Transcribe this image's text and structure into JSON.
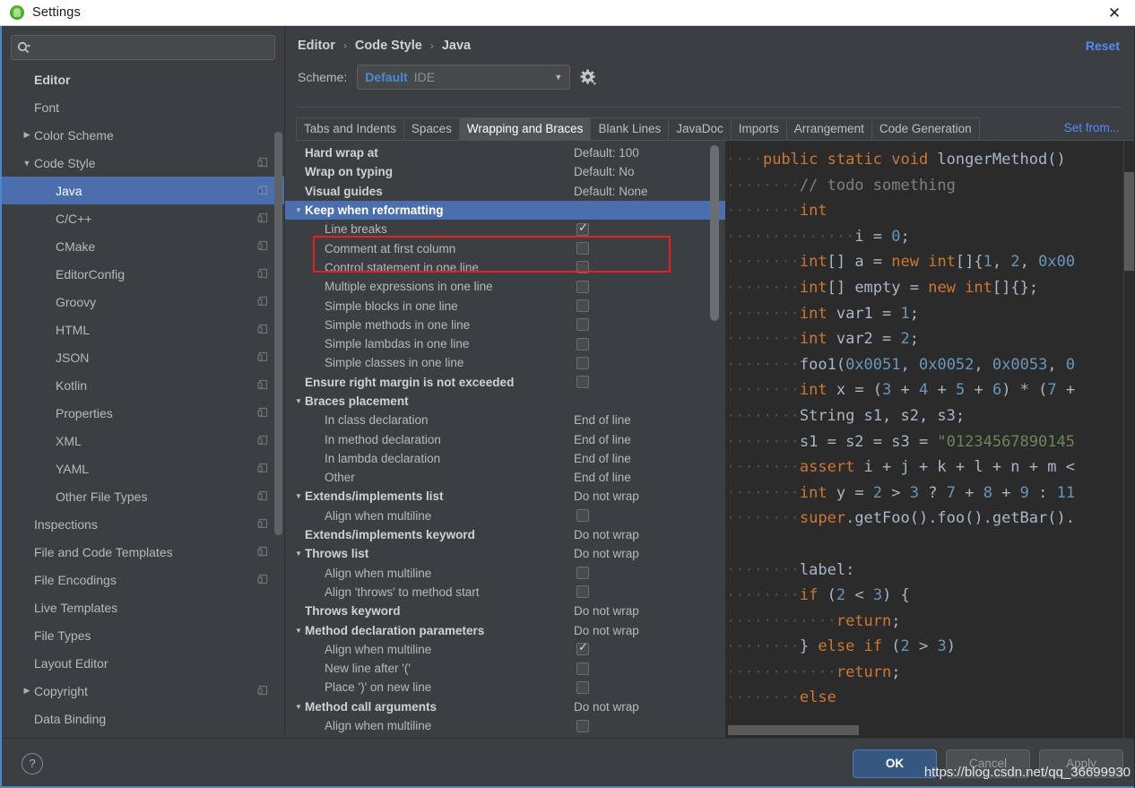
{
  "window": {
    "title": "Settings",
    "app_icon": "android-studio-icon",
    "close_icon": "close-icon"
  },
  "sidebar": {
    "search": {
      "placeholder": "",
      "value": "",
      "icon": "search-icon",
      "dropdown_icon": "chevron-down-icon"
    },
    "items": [
      {
        "label": "Editor",
        "level": 0,
        "arrow": "",
        "copy": false
      },
      {
        "label": "Font",
        "level": 1,
        "arrow": "",
        "copy": false
      },
      {
        "label": "Color Scheme",
        "level": 1,
        "arrow": "▶",
        "copy": false
      },
      {
        "label": "Code Style",
        "level": 1,
        "arrow": "▼",
        "copy": true
      },
      {
        "label": "Java",
        "level": 2,
        "arrow": "",
        "copy": true,
        "selected": true
      },
      {
        "label": "C/C++",
        "level": 2,
        "arrow": "",
        "copy": true
      },
      {
        "label": "CMake",
        "level": 2,
        "arrow": "",
        "copy": true
      },
      {
        "label": "EditorConfig",
        "level": 2,
        "arrow": "",
        "copy": true
      },
      {
        "label": "Groovy",
        "level": 2,
        "arrow": "",
        "copy": true
      },
      {
        "label": "HTML",
        "level": 2,
        "arrow": "",
        "copy": true
      },
      {
        "label": "JSON",
        "level": 2,
        "arrow": "",
        "copy": true
      },
      {
        "label": "Kotlin",
        "level": 2,
        "arrow": "",
        "copy": true
      },
      {
        "label": "Properties",
        "level": 2,
        "arrow": "",
        "copy": true
      },
      {
        "label": "XML",
        "level": 2,
        "arrow": "",
        "copy": true
      },
      {
        "label": "YAML",
        "level": 2,
        "arrow": "",
        "copy": true
      },
      {
        "label": "Other File Types",
        "level": 2,
        "arrow": "",
        "copy": true
      },
      {
        "label": "Inspections",
        "level": 1,
        "arrow": "",
        "copy": true
      },
      {
        "label": "File and Code Templates",
        "level": 1,
        "arrow": "",
        "copy": true
      },
      {
        "label": "File Encodings",
        "level": 1,
        "arrow": "",
        "copy": true
      },
      {
        "label": "Live Templates",
        "level": 1,
        "arrow": "",
        "copy": false
      },
      {
        "label": "File Types",
        "level": 1,
        "arrow": "",
        "copy": false
      },
      {
        "label": "Layout Editor",
        "level": 1,
        "arrow": "",
        "copy": false
      },
      {
        "label": "Copyright",
        "level": 1,
        "arrow": "▶",
        "copy": true
      },
      {
        "label": "Data Binding",
        "level": 1,
        "arrow": "",
        "copy": false
      }
    ]
  },
  "header": {
    "breadcrumb": [
      "Editor",
      "Code Style",
      "Java"
    ],
    "breadcrumb_separator": "›",
    "reset_label": "Reset",
    "scheme_label": "Scheme:",
    "scheme_value": "Default",
    "scheme_scope": "IDE",
    "scheme_dropdown_icon": "chevron-down-icon",
    "gear_icon": "gear-icon",
    "set_from_label": "Set from..."
  },
  "tabs": [
    {
      "label": "Tabs and Indents",
      "active": false
    },
    {
      "label": "Spaces",
      "active": false
    },
    {
      "label": "Wrapping and Braces",
      "active": true
    },
    {
      "label": "Blank Lines",
      "active": false
    },
    {
      "label": "JavaDoc",
      "active": false
    },
    {
      "label": "Imports",
      "active": false
    },
    {
      "label": "Arrangement",
      "active": false
    },
    {
      "label": "Code Generation",
      "active": false
    }
  ],
  "options": [
    {
      "label": "Hard wrap at",
      "kind": "group-nochev",
      "value": "Default: 100"
    },
    {
      "label": "Wrap on typing",
      "kind": "group-nochev",
      "value": "Default: No"
    },
    {
      "label": "Visual guides",
      "kind": "group-nochev",
      "value": "Default: None"
    },
    {
      "label": "Keep when reformatting",
      "kind": "group",
      "arrow": "▼",
      "selected": true
    },
    {
      "label": "Line breaks",
      "kind": "child",
      "checkbox": true,
      "checked": true
    },
    {
      "label": "Comment at first column",
      "kind": "child",
      "checkbox": true,
      "checked": false
    },
    {
      "label": "Control statement in one line",
      "kind": "child",
      "checkbox": true,
      "checked": false
    },
    {
      "label": "Multiple expressions in one line",
      "kind": "child",
      "checkbox": true,
      "checked": false
    },
    {
      "label": "Simple blocks in one line",
      "kind": "child",
      "checkbox": true,
      "checked": false
    },
    {
      "label": "Simple methods in one line",
      "kind": "child",
      "checkbox": true,
      "checked": false
    },
    {
      "label": "Simple lambdas in one line",
      "kind": "child",
      "checkbox": true,
      "checked": false
    },
    {
      "label": "Simple classes in one line",
      "kind": "child",
      "checkbox": true,
      "checked": false
    },
    {
      "label": "Ensure right margin is not exceeded",
      "kind": "group-nochev",
      "checkbox": true,
      "checked": false
    },
    {
      "label": "Braces placement",
      "kind": "group",
      "arrow": "▼"
    },
    {
      "label": "In class declaration",
      "kind": "child",
      "value": "End of line"
    },
    {
      "label": "In method declaration",
      "kind": "child",
      "value": "End of line"
    },
    {
      "label": "In lambda declaration",
      "kind": "child",
      "value": "End of line"
    },
    {
      "label": "Other",
      "kind": "child",
      "value": "End of line"
    },
    {
      "label": "Extends/implements list",
      "kind": "group",
      "arrow": "▼",
      "value": "Do not wrap"
    },
    {
      "label": "Align when multiline",
      "kind": "child",
      "checkbox": true,
      "checked": false
    },
    {
      "label": "Extends/implements keyword",
      "kind": "group-nochev",
      "value": "Do not wrap"
    },
    {
      "label": "Throws list",
      "kind": "group",
      "arrow": "▼",
      "value": "Do not wrap"
    },
    {
      "label": "Align when multiline",
      "kind": "child",
      "checkbox": true,
      "checked": false
    },
    {
      "label": "Align 'throws' to method start",
      "kind": "child",
      "checkbox": true,
      "checked": false
    },
    {
      "label": "Throws keyword",
      "kind": "group-nochev",
      "value": "Do not wrap"
    },
    {
      "label": "Method declaration parameters",
      "kind": "group",
      "arrow": "▼",
      "value": "Do not wrap"
    },
    {
      "label": "Align when multiline",
      "kind": "child",
      "checkbox": true,
      "checked": true
    },
    {
      "label": "New line after '('",
      "kind": "child",
      "checkbox": true,
      "checked": false
    },
    {
      "label": "Place ')' on new line",
      "kind": "child",
      "checkbox": true,
      "checked": false
    },
    {
      "label": "Method call arguments",
      "kind": "group",
      "arrow": "▼",
      "value": "Do not wrap"
    },
    {
      "label": "Align when multiline",
      "kind": "child",
      "checkbox": true,
      "checked": false
    }
  ],
  "highlight_box_color": "#ec1c24",
  "code_preview": {
    "lines": [
      [
        {
          "t": "····",
          "c": "ws"
        },
        {
          "t": "public static void ",
          "c": "kw"
        },
        {
          "t": "longerMethod()",
          "c": "pl"
        },
        {
          "t": " ",
          "c": "ws"
        }
      ],
      [
        {
          "t": "········",
          "c": "ws"
        },
        {
          "t": "// todo something",
          "c": "cmt"
        }
      ],
      [
        {
          "t": "········",
          "c": "ws"
        },
        {
          "t": "int",
          "c": "kw"
        }
      ],
      [
        {
          "t": "··············",
          "c": "ws"
        },
        {
          "t": "i = ",
          "c": "pl"
        },
        {
          "t": "0",
          "c": "num"
        },
        {
          "t": ";",
          "c": "pl"
        }
      ],
      [
        {
          "t": "········",
          "c": "ws"
        },
        {
          "t": "int",
          "c": "kw"
        },
        {
          "t": "[] a = ",
          "c": "pl"
        },
        {
          "t": "new int",
          "c": "kw"
        },
        {
          "t": "[]{",
          "c": "pl"
        },
        {
          "t": "1",
          "c": "num"
        },
        {
          "t": ", ",
          "c": "pl"
        },
        {
          "t": "2",
          "c": "num"
        },
        {
          "t": ", ",
          "c": "pl"
        },
        {
          "t": "0x00",
          "c": "num"
        }
      ],
      [
        {
          "t": "········",
          "c": "ws"
        },
        {
          "t": "int",
          "c": "kw"
        },
        {
          "t": "[] empty = ",
          "c": "pl"
        },
        {
          "t": "new int",
          "c": "kw"
        },
        {
          "t": "[]{};",
          "c": "pl"
        }
      ],
      [
        {
          "t": "········",
          "c": "ws"
        },
        {
          "t": "int",
          "c": "kw"
        },
        {
          "t": " var1 = ",
          "c": "pl"
        },
        {
          "t": "1",
          "c": "num"
        },
        {
          "t": ";",
          "c": "pl"
        }
      ],
      [
        {
          "t": "········",
          "c": "ws"
        },
        {
          "t": "int",
          "c": "kw"
        },
        {
          "t": " var2 = ",
          "c": "pl"
        },
        {
          "t": "2",
          "c": "num"
        },
        {
          "t": ";",
          "c": "pl"
        }
      ],
      [
        {
          "t": "········",
          "c": "ws"
        },
        {
          "t": "foo1(",
          "c": "pl"
        },
        {
          "t": "0x0051",
          "c": "num"
        },
        {
          "t": ", ",
          "c": "pl"
        },
        {
          "t": "0x0052",
          "c": "num"
        },
        {
          "t": ", ",
          "c": "pl"
        },
        {
          "t": "0x0053",
          "c": "num"
        },
        {
          "t": ", ",
          "c": "pl"
        },
        {
          "t": "0",
          "c": "num"
        }
      ],
      [
        {
          "t": "········",
          "c": "ws"
        },
        {
          "t": "int",
          "c": "kw"
        },
        {
          "t": " x = (",
          "c": "pl"
        },
        {
          "t": "3",
          "c": "num"
        },
        {
          "t": " + ",
          "c": "pl"
        },
        {
          "t": "4",
          "c": "num"
        },
        {
          "t": " + ",
          "c": "pl"
        },
        {
          "t": "5",
          "c": "num"
        },
        {
          "t": " + ",
          "c": "pl"
        },
        {
          "t": "6",
          "c": "num"
        },
        {
          "t": ") * (",
          "c": "pl"
        },
        {
          "t": "7",
          "c": "num"
        },
        {
          "t": " +",
          "c": "pl"
        }
      ],
      [
        {
          "t": "········",
          "c": "ws"
        },
        {
          "t": "String",
          "c": "pl"
        },
        {
          "t": " s1, s2, s3;",
          "c": "pl"
        }
      ],
      [
        {
          "t": "········",
          "c": "ws"
        },
        {
          "t": "s1 = s2 = s3 = ",
          "c": "pl"
        },
        {
          "t": "\"0123456789014",
          "c": "str"
        },
        {
          "t": "5",
          "c": "str"
        }
      ],
      [
        {
          "t": "········",
          "c": "ws"
        },
        {
          "t": "assert",
          "c": "kw"
        },
        {
          "t": " i + j + k + l + n + m <",
          "c": "pl"
        }
      ],
      [
        {
          "t": "········",
          "c": "ws"
        },
        {
          "t": "int",
          "c": "kw"
        },
        {
          "t": " y = ",
          "c": "pl"
        },
        {
          "t": "2",
          "c": "num"
        },
        {
          "t": " > ",
          "c": "pl"
        },
        {
          "t": "3",
          "c": "num"
        },
        {
          "t": " ? ",
          "c": "pl"
        },
        {
          "t": "7",
          "c": "num"
        },
        {
          "t": " + ",
          "c": "pl"
        },
        {
          "t": "8",
          "c": "num"
        },
        {
          "t": " + ",
          "c": "pl"
        },
        {
          "t": "9",
          "c": "num"
        },
        {
          "t": " : ",
          "c": "pl"
        },
        {
          "t": "11",
          "c": "num"
        }
      ],
      [
        {
          "t": "········",
          "c": "ws"
        },
        {
          "t": "super",
          "c": "kw"
        },
        {
          "t": ".getFoo().foo().getBar().",
          "c": "pl"
        }
      ],
      [
        {
          "t": "",
          "c": "pl"
        }
      ],
      [
        {
          "t": "········",
          "c": "ws"
        },
        {
          "t": "label:",
          "c": "pl"
        }
      ],
      [
        {
          "t": "········",
          "c": "ws"
        },
        {
          "t": "if",
          "c": "kw"
        },
        {
          "t": " (",
          "c": "pl"
        },
        {
          "t": "2",
          "c": "num"
        },
        {
          "t": " < ",
          "c": "pl"
        },
        {
          "t": "3",
          "c": "num"
        },
        {
          "t": ") {",
          "c": "pl"
        }
      ],
      [
        {
          "t": "············",
          "c": "ws"
        },
        {
          "t": "return",
          "c": "kw"
        },
        {
          "t": ";",
          "c": "pl"
        }
      ],
      [
        {
          "t": "········",
          "c": "ws"
        },
        {
          "t": "} ",
          "c": "pl"
        },
        {
          "t": "else if",
          "c": "kw"
        },
        {
          "t": " (",
          "c": "pl"
        },
        {
          "t": "2",
          "c": "num"
        },
        {
          "t": " > ",
          "c": "pl"
        },
        {
          "t": "3",
          "c": "num"
        },
        {
          "t": ")",
          "c": "pl"
        }
      ],
      [
        {
          "t": "············",
          "c": "ws"
        },
        {
          "t": "return",
          "c": "kw"
        },
        {
          "t": ";",
          "c": "pl"
        }
      ],
      [
        {
          "t": "········",
          "c": "ws"
        },
        {
          "t": "else",
          "c": "kw"
        }
      ]
    ]
  },
  "footer": {
    "help_label": "?",
    "ok_label": "OK",
    "cancel_label": "Cancel",
    "apply_label": "Apply"
  },
  "watermark": "https://blog.csdn.net/qq_36699930"
}
